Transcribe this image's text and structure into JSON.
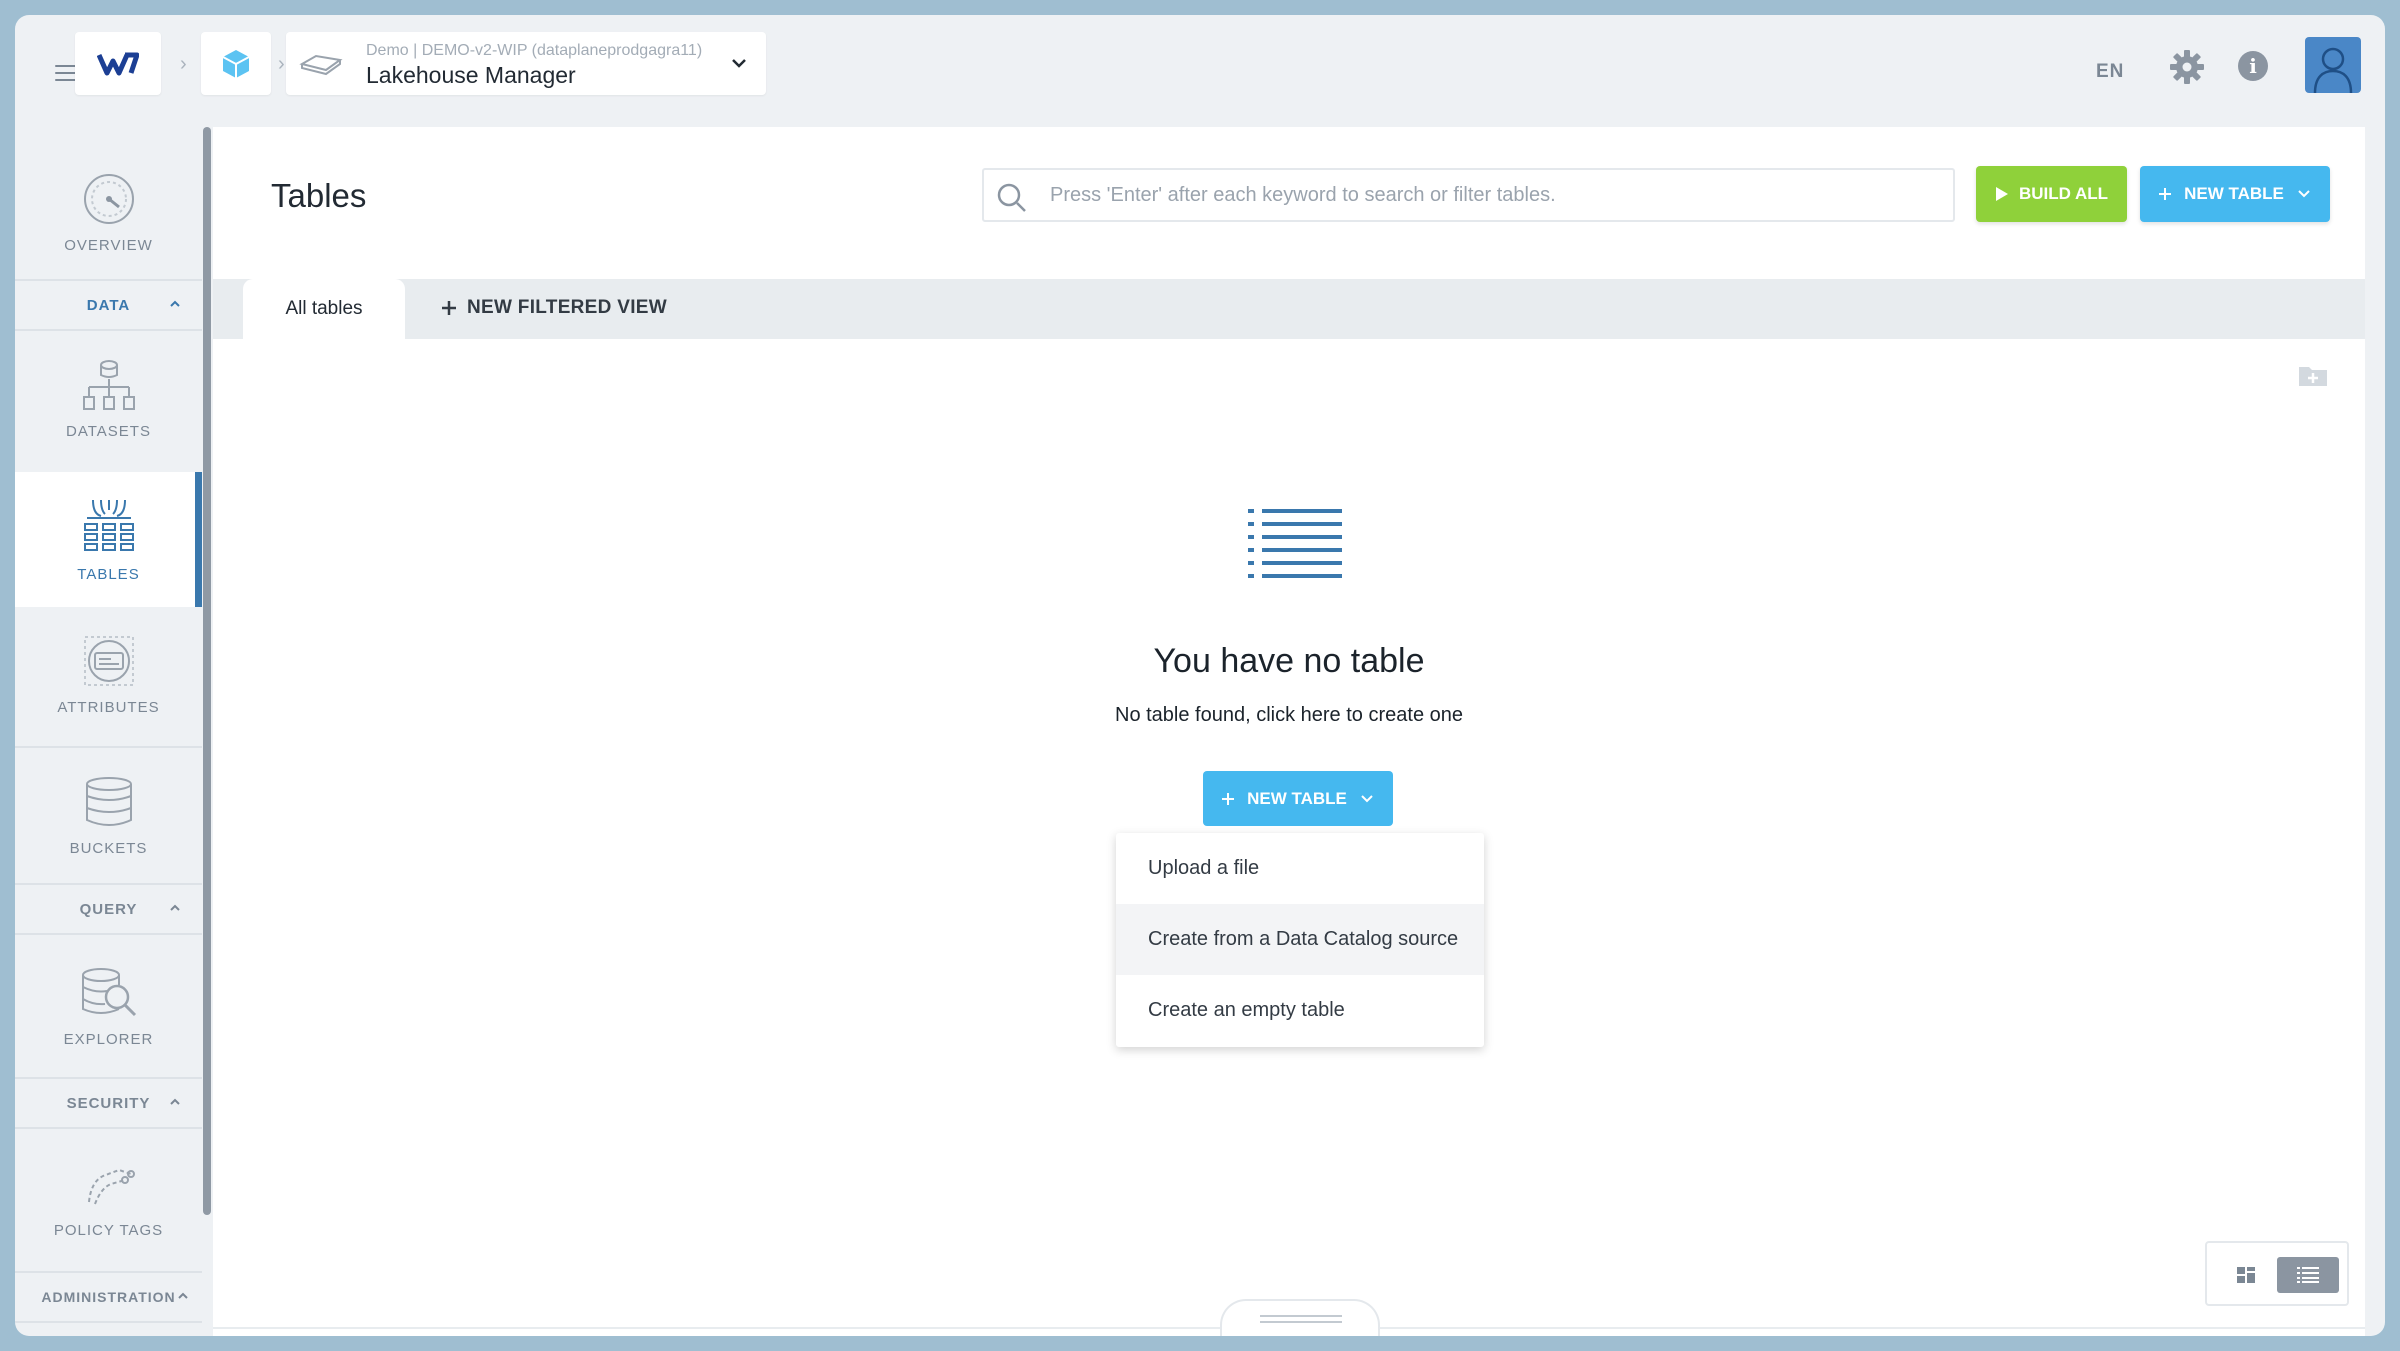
{
  "topbar": {
    "org_line": "Demo | DEMO-v2-WIP (dataplaneprodgagra11)",
    "app_title": "Lakehouse Manager",
    "language": "EN"
  },
  "sidebar": {
    "overview": "OVERVIEW",
    "section_data": "DATA",
    "datasets": "DATASETS",
    "tables": "TABLES",
    "attributes": "ATTRIBUTES",
    "buckets": "BUCKETS",
    "section_query": "QUERY",
    "explorer": "EXPLORER",
    "section_security": "SECURITY",
    "policy_tags": "POLICY TAGS",
    "section_administration": "ADMINISTRATION"
  },
  "main": {
    "title": "Tables",
    "search_placeholder": "Press 'Enter' after each keyword to search or filter tables.",
    "build_all": "BUILD ALL",
    "new_table": "NEW TABLE",
    "tab_all": "All tables",
    "tab_new_filtered": "NEW FILTERED VIEW",
    "empty_title": "You have no table",
    "empty_subtitle": "No table found, click here to create one",
    "center_new_table": "NEW TABLE",
    "menu": [
      "Upload a file",
      "Create from a Data Catalog source",
      "Create an empty table"
    ]
  },
  "colors": {
    "accent_blue": "#45b8ef",
    "build_green": "#8fd13a",
    "active_blue": "#3a78ad"
  }
}
